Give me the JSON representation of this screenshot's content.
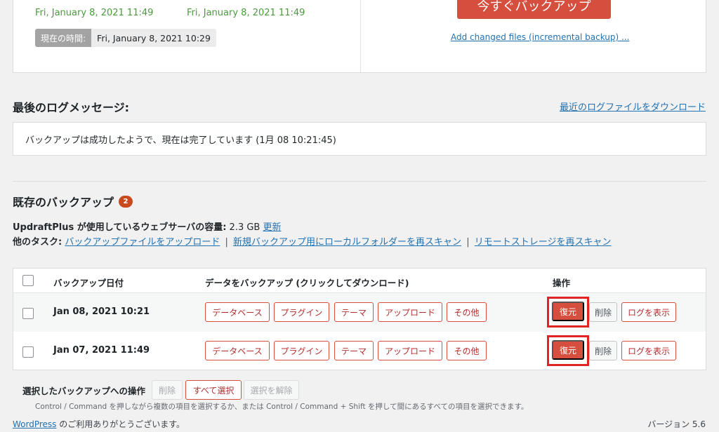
{
  "status": {
    "next_files_time": "Fri, January 8, 2021 11:49",
    "next_db_time": "Fri, January 8, 2021 11:49",
    "now_label": "現在の時間:",
    "now_value": "Fri, January 8, 2021 10:29",
    "backup_now_label": "今すぐバックアップ",
    "incremental_link": "Add changed files (incremental backup) ..."
  },
  "log": {
    "heading": "最後のログメッセージ:",
    "download_link": "最近のログファイルをダウンロード",
    "message": "バックアップは成功したようで、現在は完了しています (1月 08 10:21:45)"
  },
  "existing": {
    "heading": "既存のバックアップ",
    "count": "2",
    "usage_label": "UpdraftPlus が使用しているウェブサーバの容量:",
    "usage_value": "2.3 GB",
    "usage_refresh": "更新",
    "tasks_label": "他のタスク:",
    "tasks": [
      "バックアップファイルをアップロード",
      "新規バックアップ用にローカルフォルダーを再スキャン",
      "リモートストレージを再スキャン"
    ],
    "separator": "|"
  },
  "table": {
    "col_date": "バックアップ日付",
    "col_data": "データをバックアップ (クリックしてダウンロード)",
    "col_actions": "操作",
    "entity_labels": [
      "データベース",
      "プラグイン",
      "テーマ",
      "アップロード",
      "その他"
    ],
    "restore_label": "復元",
    "delete_label": "削除",
    "view_log_label": "ログを表示",
    "rows": [
      {
        "date": "Jan 08, 2021 10:21"
      },
      {
        "date": "Jan 07, 2021 11:49"
      }
    ]
  },
  "bulk": {
    "label": "選択したバックアップへの操作",
    "delete": "削除",
    "select_all": "すべて選択",
    "deselect": "選択を解除",
    "hint": "Control / Command を押しながら複数の項目を選択するか、または Control / Command + Shift を押して間にあるすべての項目を選択できます。"
  },
  "footer": {
    "wordpress_link": "WordPress",
    "thanks": " のご利用ありがとうございます。",
    "version": "バージョン 5.6"
  }
}
